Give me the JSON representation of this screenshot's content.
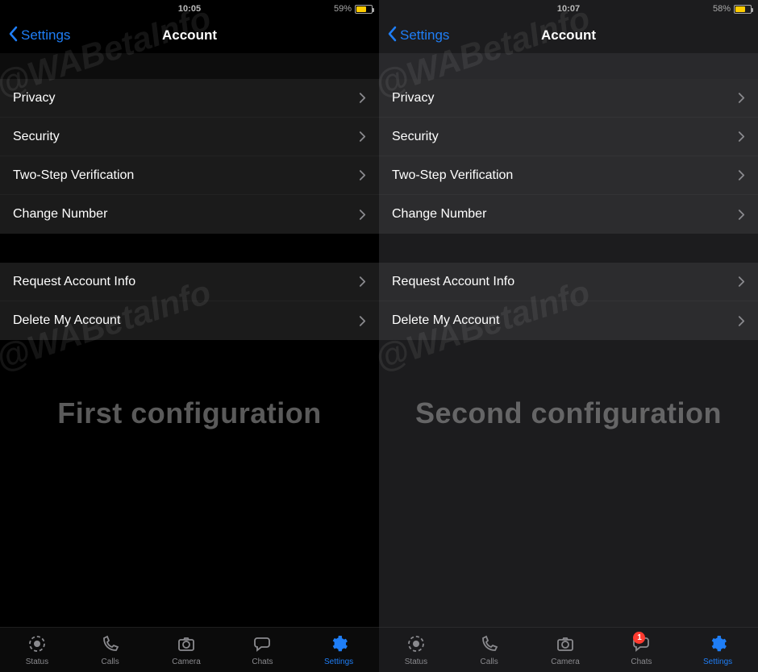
{
  "watermark_text": "@WABetaInfo",
  "screens": [
    {
      "variant": "left",
      "status": {
        "time": "10:05",
        "battery_text": "59%"
      },
      "back_label": "Settings",
      "title": "Account",
      "group1": [
        {
          "label": "Privacy"
        },
        {
          "label": "Security"
        },
        {
          "label": "Two-Step Verification"
        },
        {
          "label": "Change Number"
        }
      ],
      "group2": [
        {
          "label": "Request Account Info"
        },
        {
          "label": "Delete My Account"
        }
      ],
      "caption": "First configuration",
      "tabs": [
        {
          "label": "Status"
        },
        {
          "label": "Calls"
        },
        {
          "label": "Camera"
        },
        {
          "label": "Chats"
        },
        {
          "label": "Settings",
          "active": true
        }
      ],
      "chats_badge": null
    },
    {
      "variant": "right",
      "status": {
        "time": "10:07",
        "battery_text": "58%"
      },
      "back_label": "Settings",
      "title": "Account",
      "group1": [
        {
          "label": "Privacy"
        },
        {
          "label": "Security"
        },
        {
          "label": "Two-Step Verification"
        },
        {
          "label": "Change Number"
        }
      ],
      "group2": [
        {
          "label": "Request Account Info"
        },
        {
          "label": "Delete My Account"
        }
      ],
      "caption": "Second configuration",
      "tabs": [
        {
          "label": "Status"
        },
        {
          "label": "Calls"
        },
        {
          "label": "Camera"
        },
        {
          "label": "Chats"
        },
        {
          "label": "Settings",
          "active": true
        }
      ],
      "chats_badge": "1"
    }
  ]
}
